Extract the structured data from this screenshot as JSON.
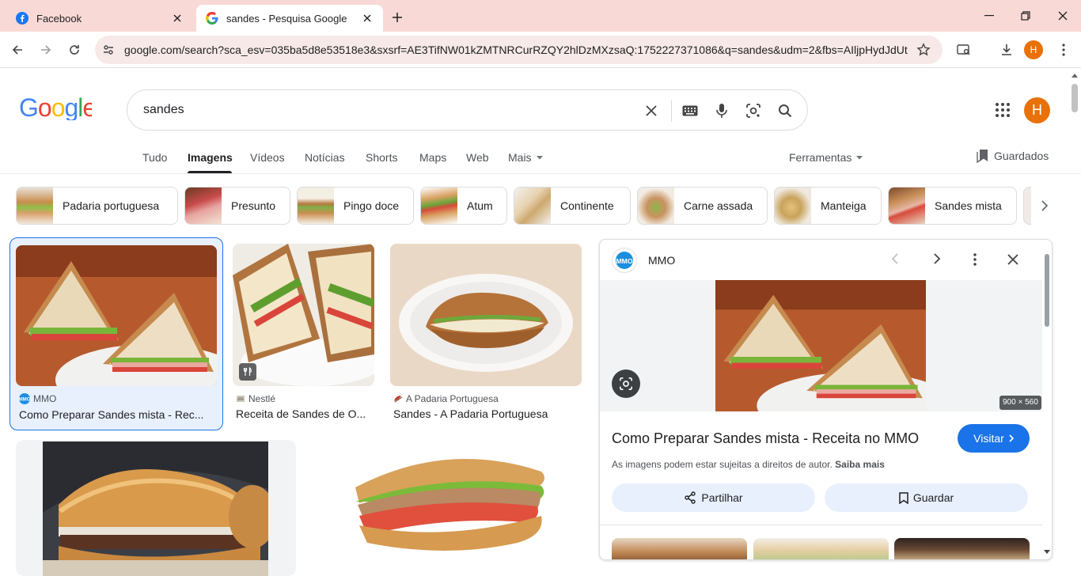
{
  "tabs": [
    {
      "title": "Facebook",
      "icon": "facebook-icon"
    },
    {
      "title": "sandes - Pesquisa Google",
      "icon": "google-icon"
    }
  ],
  "toolbar": {
    "url": "google.com/search?sca_esv=035ba5d8e53518e3&sxsrf=AE3TifNW01kZMTNRCurRZQY2hlDzMXzsaQ:1752227371086&q=sandes&udm=2&fbs=AIljpHydJdUt...",
    "profile_initial": "H"
  },
  "google": {
    "logo": "Google",
    "query": "sandes",
    "avatar_initial": "H"
  },
  "nav": {
    "items": [
      "Tudo",
      "Imagens",
      "Vídeos",
      "Notícias",
      "Shorts",
      "Maps",
      "Web",
      "Mais"
    ],
    "active": "Imagens",
    "tools": "Ferramentas",
    "saved": "Guardados"
  },
  "chips": [
    "Padaria portuguesa",
    "Presunto",
    "Pingo doce",
    "Atum",
    "Continente",
    "Carne assada",
    "Manteiga",
    "Sandes mista"
  ],
  "results": [
    {
      "source": "MMO",
      "title": "Como Preparar Sandes mista - Rec..."
    },
    {
      "source": "Nestlé",
      "title": "Receita de Sandes de O..."
    },
    {
      "source": "A Padaria Portuguesa",
      "title": "Sandes - A Padaria Portuguesa"
    }
  ],
  "panel": {
    "source": "MMO",
    "dimensions": "900 × 560",
    "title": "Como Preparar Sandes mista - Receita no MMO",
    "visit": "Visitar",
    "copyright": "As imagens podem estar sujeitas a direitos de autor.",
    "learn_more": "Saiba mais",
    "share": "Partilhar",
    "save": "Guardar"
  },
  "colors": {
    "accent": "#1a73e8",
    "tabstrip": "#f9d9d6",
    "avatar": "#e8710a"
  }
}
